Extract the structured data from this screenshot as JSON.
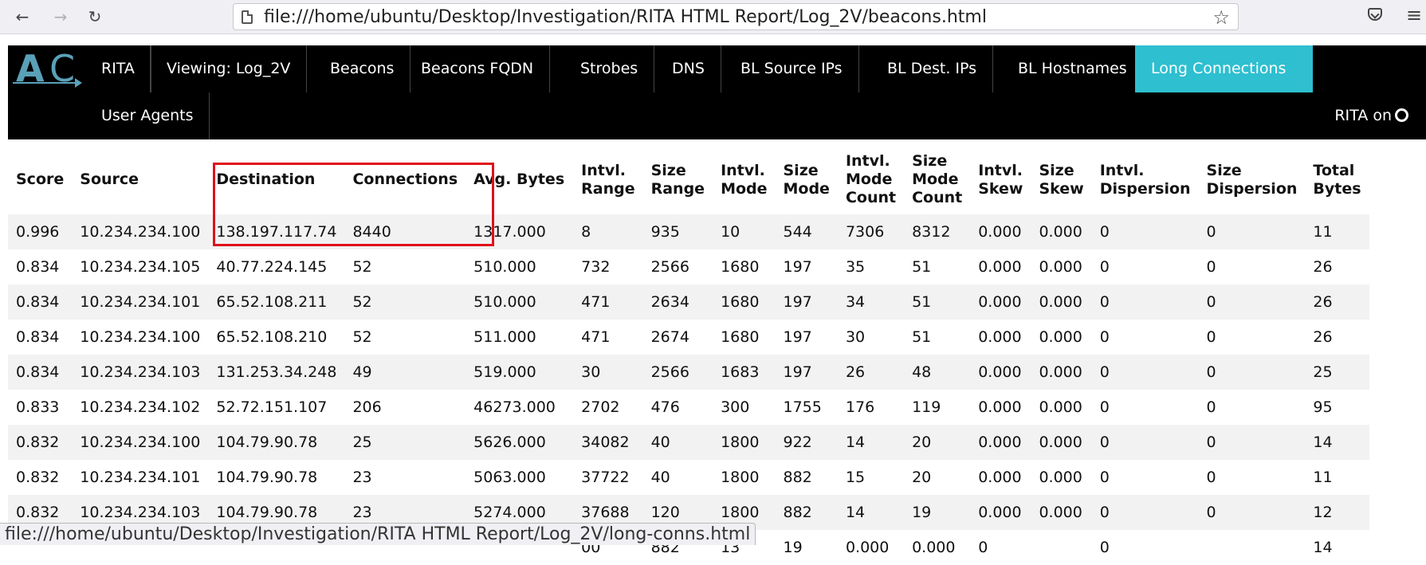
{
  "browser": {
    "url": "file:///home/ubuntu/Desktop/Investigation/RITA HTML Report/Log_2V/beacons.html",
    "status_url": "file:///home/ubuntu/Desktop/Investigation/RITA HTML Report/Log_2V/long-conns.html"
  },
  "nav": {
    "items": [
      "RITA",
      "Viewing: Log_2V",
      "Beacons",
      "Beacons FQDN",
      "Strobes",
      "DNS",
      "BL Source IPs",
      "BL Dest. IPs",
      "BL Hostnames",
      "Long Connections",
      "User Agents"
    ],
    "active": "Long Connections",
    "right_text": "RITA on"
  },
  "table": {
    "headers": [
      "Score",
      "Source",
      "Destination",
      "Connections",
      "Avg. Bytes",
      "Intvl. Range",
      "Size Range",
      "Intvl. Mode",
      "Size Mode",
      "Intvl. Mode Count",
      "Size Mode Count",
      "Intvl. Skew",
      "Size Skew",
      "Intvl. Dispersion",
      "Size Dispersion",
      "Total Bytes"
    ],
    "rows": [
      [
        "0.996",
        "10.234.234.100",
        "138.197.117.74",
        "8440",
        "1317.000",
        "8",
        "935",
        "10",
        "544",
        "7306",
        "8312",
        "0.000",
        "0.000",
        "0",
        "0",
        "11"
      ],
      [
        "0.834",
        "10.234.234.105",
        "40.77.224.145",
        "52",
        "510.000",
        "732",
        "2566",
        "1680",
        "197",
        "35",
        "51",
        "0.000",
        "0.000",
        "0",
        "0",
        "26"
      ],
      [
        "0.834",
        "10.234.234.101",
        "65.52.108.211",
        "52",
        "510.000",
        "471",
        "2634",
        "1680",
        "197",
        "34",
        "51",
        "0.000",
        "0.000",
        "0",
        "0",
        "26"
      ],
      [
        "0.834",
        "10.234.234.100",
        "65.52.108.210",
        "52",
        "511.000",
        "471",
        "2674",
        "1680",
        "197",
        "30",
        "51",
        "0.000",
        "0.000",
        "0",
        "0",
        "26"
      ],
      [
        "0.834",
        "10.234.234.103",
        "131.253.34.248",
        "49",
        "519.000",
        "30",
        "2566",
        "1683",
        "197",
        "26",
        "48",
        "0.000",
        "0.000",
        "0",
        "0",
        "25"
      ],
      [
        "0.833",
        "10.234.234.102",
        "52.72.151.107",
        "206",
        "46273.000",
        "2702",
        "476",
        "300",
        "1755",
        "176",
        "119",
        "0.000",
        "0.000",
        "0",
        "0",
        "95"
      ],
      [
        "0.832",
        "10.234.234.100",
        "104.79.90.78",
        "25",
        "5626.000",
        "34082",
        "40",
        "1800",
        "922",
        "14",
        "20",
        "0.000",
        "0.000",
        "0",
        "0",
        "14"
      ],
      [
        "0.832",
        "10.234.234.101",
        "104.79.90.78",
        "23",
        "5063.000",
        "37722",
        "40",
        "1800",
        "882",
        "15",
        "20",
        "0.000",
        "0.000",
        "0",
        "0",
        "11"
      ],
      [
        "0.832",
        "10.234.234.103",
        "104.79.90.78",
        "23",
        "5274.000",
        "37688",
        "120",
        "1800",
        "882",
        "14",
        "19",
        "0.000",
        "0.000",
        "0",
        "0",
        "12"
      ],
      [
        "",
        "",
        "",
        "",
        "",
        "00",
        "882",
        "13",
        "19",
        "0.000",
        "0.000",
        "0",
        "",
        "0",
        "",
        "14"
      ]
    ]
  }
}
